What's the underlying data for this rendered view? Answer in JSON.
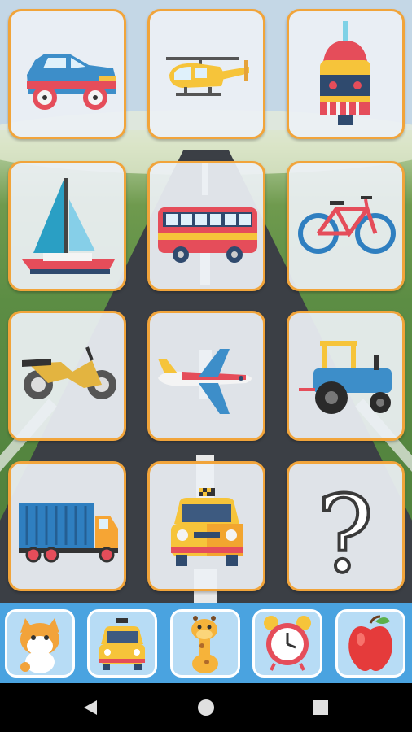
{
  "theme": {
    "card_border": "#f1a43a",
    "bottom_bar": "#4aa3e0",
    "tab_border": "#ffffff"
  },
  "grid": {
    "items": [
      {
        "icon": "car-icon"
      },
      {
        "icon": "helicopter-icon"
      },
      {
        "icon": "cable-car-icon"
      },
      {
        "icon": "sailboat-icon"
      },
      {
        "icon": "bus-icon"
      },
      {
        "icon": "bicycle-icon"
      },
      {
        "icon": "motorcycle-icon"
      },
      {
        "icon": "airplane-icon"
      },
      {
        "icon": "tractor-icon"
      },
      {
        "icon": "truck-icon"
      },
      {
        "icon": "taxi-icon"
      },
      {
        "icon": "question-mark-icon",
        "text": "?"
      }
    ]
  },
  "categories": [
    {
      "icon": "cat-icon"
    },
    {
      "icon": "taxi-icon",
      "selected": true
    },
    {
      "icon": "giraffe-icon"
    },
    {
      "icon": "alarm-clock-icon"
    },
    {
      "icon": "apple-icon"
    }
  ],
  "navigation": {
    "back": "back-icon",
    "home": "home-icon",
    "recents": "recents-icon"
  }
}
